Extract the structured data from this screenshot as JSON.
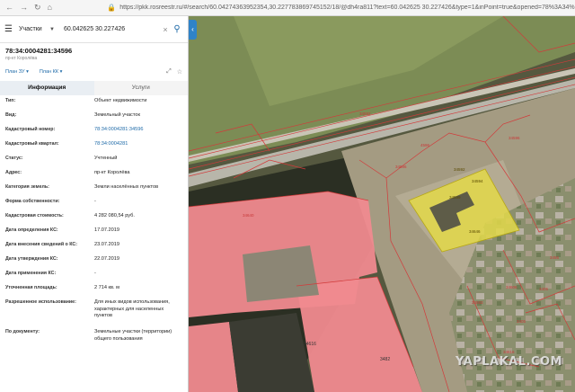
{
  "browser": {
    "url_host": "https://pkk.rosreestr.ru",
    "url_path": "/#/search/60.04274363952354,30.227783869745152/18/@dh4ra811?text=60.042625 30.227426&type=1&inPoint=true&opened=78%3A34%",
    "back_icon": "arrow-left",
    "forward_icon": "arrow-right",
    "reload_icon": "reload",
    "home_icon": "home"
  },
  "search": {
    "scope": "Участки",
    "query": "60.042625 30.227426"
  },
  "object": {
    "cadastral_number": "78:34:0004281:34596",
    "address_sub": "пр-кт Королёва",
    "plan_zu": "План ЗУ",
    "plan_kk": "План КК"
  },
  "tabs": {
    "info": "Информация",
    "services": "Услуги"
  },
  "fields": [
    {
      "key": "Тип:",
      "value": "Объект недвижимости"
    },
    {
      "key": "Вид:",
      "value": "Земельный участок"
    },
    {
      "key": "Кадастровый номер:",
      "value": "78:34:0004281:34596"
    },
    {
      "key": "Кадастровый квартал:",
      "value": "78:34:0004281"
    },
    {
      "key": "Статус:",
      "value": "Учтенный"
    },
    {
      "key": "Адрес:",
      "value": "пр-кт Королёва"
    },
    {
      "key": "Категория земель:",
      "value": "Земли населённых пунктов"
    },
    {
      "key": "Форма собственности:",
      "value": "-"
    },
    {
      "key": "Кадастровая стоимость:",
      "value": "4 282 080,54 руб."
    },
    {
      "key": "Дата определения КС:",
      "value": "17.07.2019"
    },
    {
      "key": "Дата внесения сведений о КС:",
      "value": "23.07.2019"
    },
    {
      "key": "Дата утверждения КС:",
      "value": "22.07.2019"
    },
    {
      "key": "Дата применения КС:",
      "value": "-"
    },
    {
      "key": "Уточненная площадь:",
      "value": "2 714 кв. м"
    },
    {
      "key": "Разрешенное использование:",
      "value": "Для иных видов использования, характерных для населенных пунктов"
    },
    {
      "key": "По документу:",
      "value": "Земельные участки (территории) общего пользования"
    }
  ],
  "map_labels": {
    "l1": "4596",
    "l2": "34596",
    "l3": "34596",
    "l4": "34592",
    "l5": "34594",
    "l6": "34599",
    "l7": "34646",
    "l8": "34640",
    "l9": "34606",
    "l10": "3405",
    "l11": "34593",
    "l12": "3405",
    "l13": "34616",
    "l14": "3482",
    "l15": "3456",
    "l16": "34592",
    "l17": "34616"
  },
  "watermark": "YAPLAKAL.COM",
  "colors": {
    "parcel_selected": "#e3d94a",
    "building_pink": "#f08a8f",
    "boundary_red": "#d23a3a",
    "link_blue": "#1e6aa8"
  }
}
